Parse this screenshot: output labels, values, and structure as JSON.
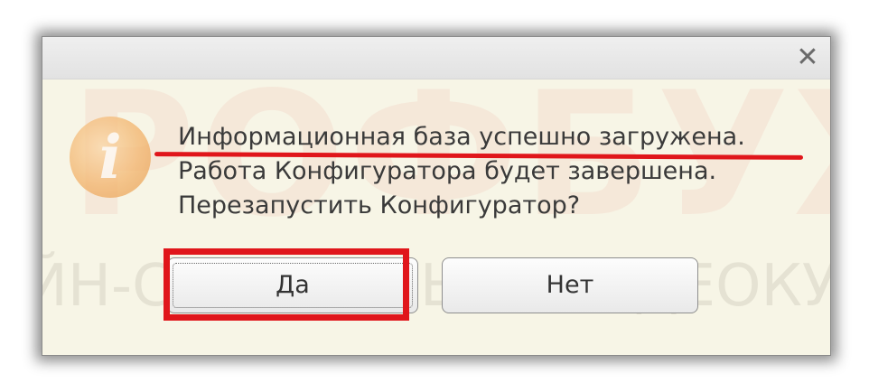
{
  "dialog": {
    "close_symbol": "✕",
    "icon": "info-icon",
    "message_lines": [
      "Информационная база успешно загружена.",
      "Работа Конфигуратора будет завершена.",
      "Перезапустить Конфигуратор?"
    ],
    "buttons": {
      "yes_label": "Да",
      "no_label": "Нет"
    }
  },
  "watermark": {
    "big_text": "РОФБУХ",
    "line_text": "ЙН-СЕМИНАРЫ И ВИДЕОКУРСЫ"
  },
  "colors": {
    "dialog_bg": "#f7f5e6",
    "annotation_red": "#e0161b",
    "text": "#3a3a3a"
  }
}
